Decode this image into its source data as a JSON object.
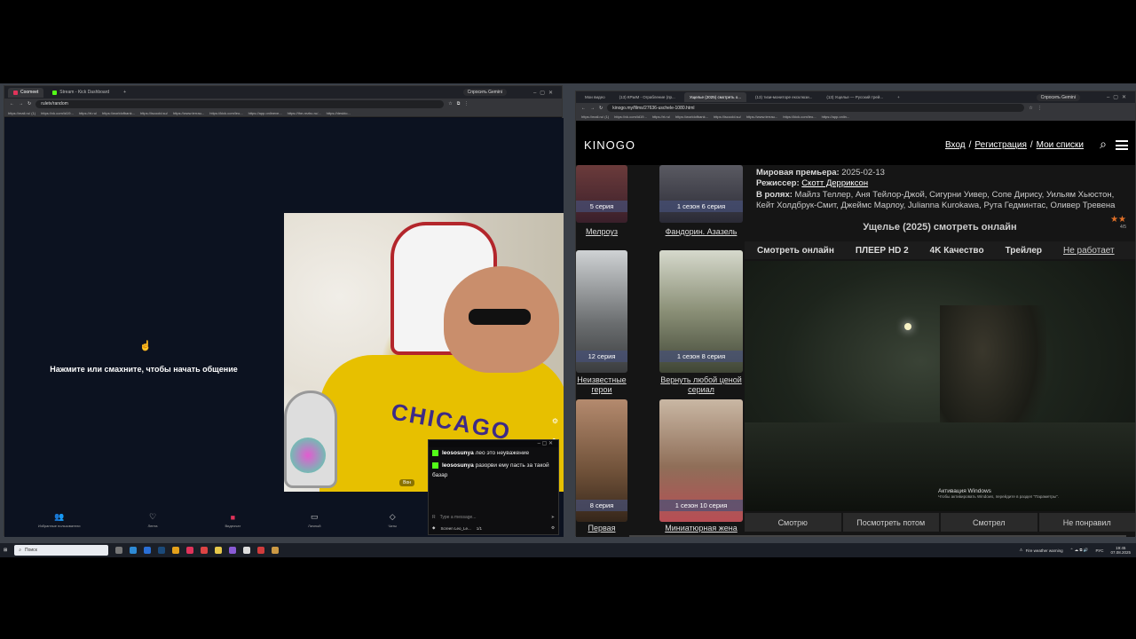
{
  "left_window": {
    "tabs": [
      {
        "label": "Coomeet",
        "color": "#e0335a"
      },
      {
        "label": "Stream - Kick Dashboard",
        "color": "#53fc18"
      }
    ],
    "url": "ruletv/random",
    "gemini": "Спросить Gemini",
    "bookmarks": [
      "https://mail.ru/ (1)",
      "https://vk.com/id19...",
      "https://rt.ru/",
      "https://worldofbank...",
      "https://iscoold.su/",
      "https://www.terrau...",
      "https://kick.com/leo...",
      "https://app.onlineve...",
      "https://the-rezbu.ru/...",
      "https://deskto..."
    ],
    "start_text": "Нажмите или смахните, чтобы начать общение",
    "video_shirt_text": "CHICAGO",
    "video_badge": "Вон",
    "nav": [
      {
        "icon": "people-icon",
        "label": "Избранные пользователи"
      },
      {
        "icon": "hearts-icon",
        "label": "Лента"
      },
      {
        "icon": "video-chat-icon",
        "label": "Видеочат"
      },
      {
        "icon": "chat-icon",
        "label": "Личный"
      },
      {
        "icon": "messages-icon",
        "label": "Чаты"
      }
    ]
  },
  "chat": {
    "messages": [
      {
        "user": "leososunya",
        "text": "лео это неуважение"
      },
      {
        "user": "leososunya",
        "text": "разорви ему пасть за такой базар"
      }
    ],
    "input_placeholder": "Type a message...",
    "footer_name": "Screen Leo_Le...",
    "footer_count": "1/1"
  },
  "right_window": {
    "tabs": [
      "Мои видео",
      "(13) КРЫМ - Ограбление (пр...",
      "Ущелье (2025) смотреть о...",
      "(13) тизи-мониторе ексклюзи...",
      "(13) Ущелье — Русский трей..."
    ],
    "url": "kinogo.my/films/27636-uschele-1080.html",
    "gemini": "Спросить Gemini",
    "bookmarks": [
      "https://mail.ru/ (1)",
      "https://vk.com/id19...",
      "https://rt.ru/",
      "https://worldofbank...",
      "https://iscoold.su/",
      "https://www.terrau...",
      "https://kick.com/leo...",
      "https://app.onlin..."
    ]
  },
  "kinogo": {
    "logo": "KINOGO",
    "login": "Вход",
    "register": "Регистрация",
    "my_lists": "Мои списки",
    "sep": "/",
    "premiere_label": "Мировая премьера:",
    "premiere_value": "2025-02-13",
    "director_label": "Режиссер:",
    "director_value": "Скотт Дерриксон",
    "cast_label": "В ролях:",
    "cast_value": "Майлз Теллер, Аня Тейлор-Джой, Сигурни Уивер, Сопе Дирису, Уильям Хьюстон, Кейт Холдбрук-Смит, Джеймс Марлоу, Julianna Kurokawa, Рута Гедминтас, Оливер Тревена",
    "rating": "4/5",
    "watch_title": "Ущелье (2025) смотреть онлайн",
    "player_tabs": [
      "Смотреть онлайн",
      "ПЛЕЕР HD 2",
      "4K Качество",
      "Трейлер"
    ],
    "broken_link": "Не работает",
    "votes": [
      "Смотрю",
      "Посмотреть потом",
      "Смотрел",
      "Не понравил"
    ],
    "activation_title": "Активация Windows",
    "activation_sub": "Чтобы активировать Windows, перейдите в раздел \"Параметры\".",
    "posters_left": [
      {
        "badge": "5 серия",
        "title": "Мелроуз"
      },
      {
        "badge": "12 серия",
        "title": "Неизвестные герои"
      },
      {
        "badge": "8 серия",
        "title": "Первая ракетка"
      }
    ],
    "posters_right": [
      {
        "badge": "1 сезон 6 серия",
        "title": "Фандорин. Азазель"
      },
      {
        "badge": "1 сезон 8 серия",
        "title": "Вернуть любой ценой сериал"
      },
      {
        "badge": "1 сезон 10 серия",
        "title": "Миниатюрная жена"
      }
    ]
  },
  "taskbar": {
    "search_placeholder": "Поиск",
    "weather": "Fire weather warning",
    "lang": "РУС",
    "time": "19:45",
    "date": "07.08.2025"
  }
}
